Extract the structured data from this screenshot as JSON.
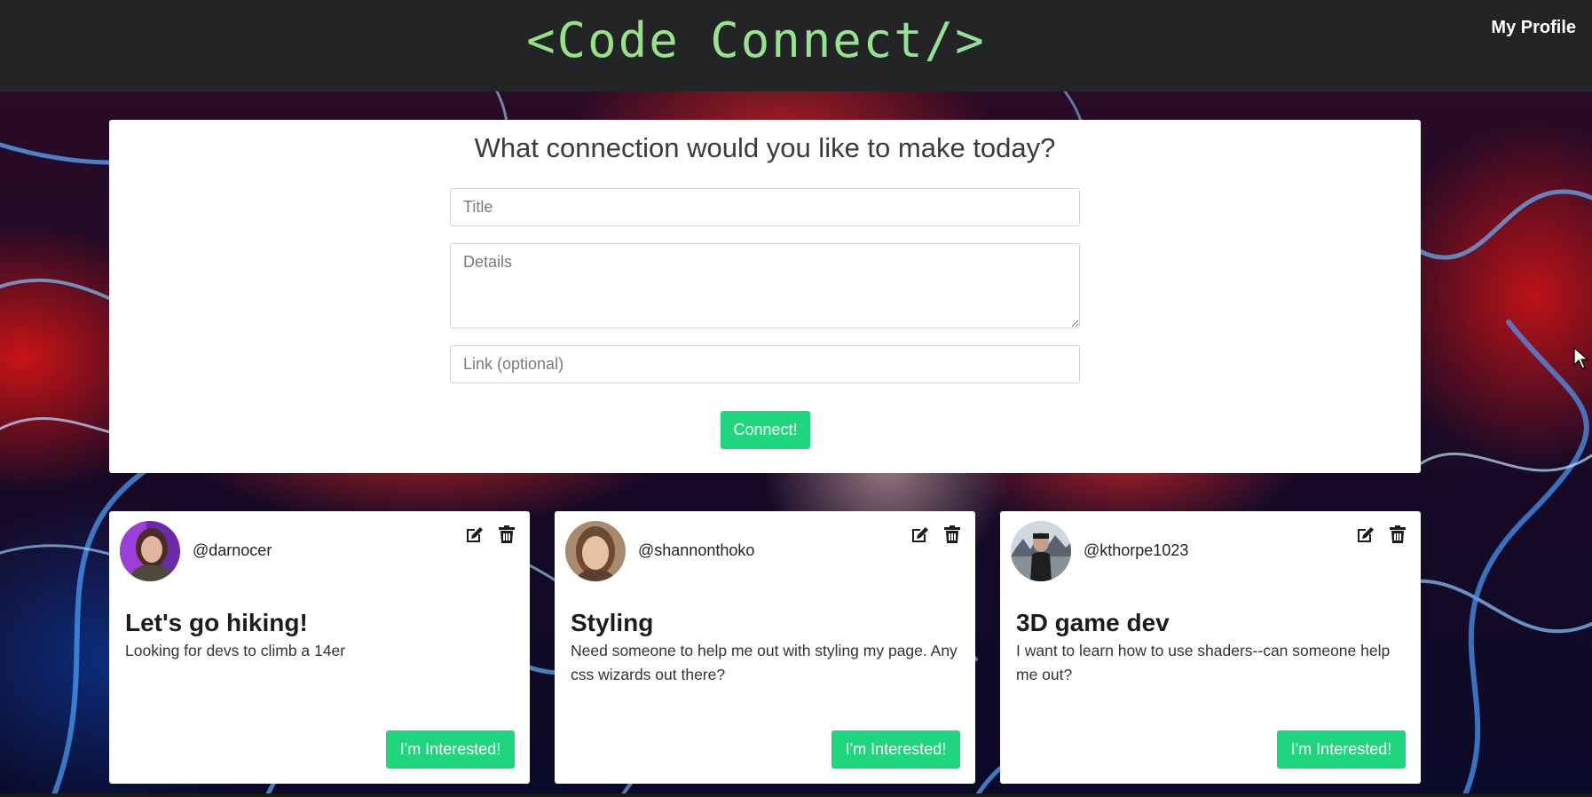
{
  "header": {
    "brand": "<Code Connect/>",
    "profile_link": "My Profile"
  },
  "form": {
    "heading": "What connection would you like to make today?",
    "title_placeholder": "Title",
    "details_placeholder": "Details",
    "link_placeholder": "Link (optional)",
    "submit_label": "Connect!"
  },
  "posts": [
    {
      "username": "@darnocer",
      "title": "Let's go hiking!",
      "body": "Looking for devs to climb a 14er",
      "button_label": "I'm Interested!"
    },
    {
      "username": "@shannonthoko",
      "title": "Styling",
      "body": "Need someone to help me out with styling my page. Any css wizards out there?",
      "button_label": "I'm Interested!"
    },
    {
      "username": "@kthorpe1023",
      "title": "3D game dev",
      "body": "I want to learn how to use shaders--can someone help me out?",
      "button_label": "I'm Interested!"
    }
  ],
  "colors": {
    "navbar": "#232426",
    "brand_green": "#7fdc7a",
    "accent_button": "#1fd67f",
    "panel": "#ffffff"
  },
  "icons": {
    "edit": "edit-icon",
    "delete": "trash-icon",
    "cursor": "mouse-pointer-icon"
  }
}
